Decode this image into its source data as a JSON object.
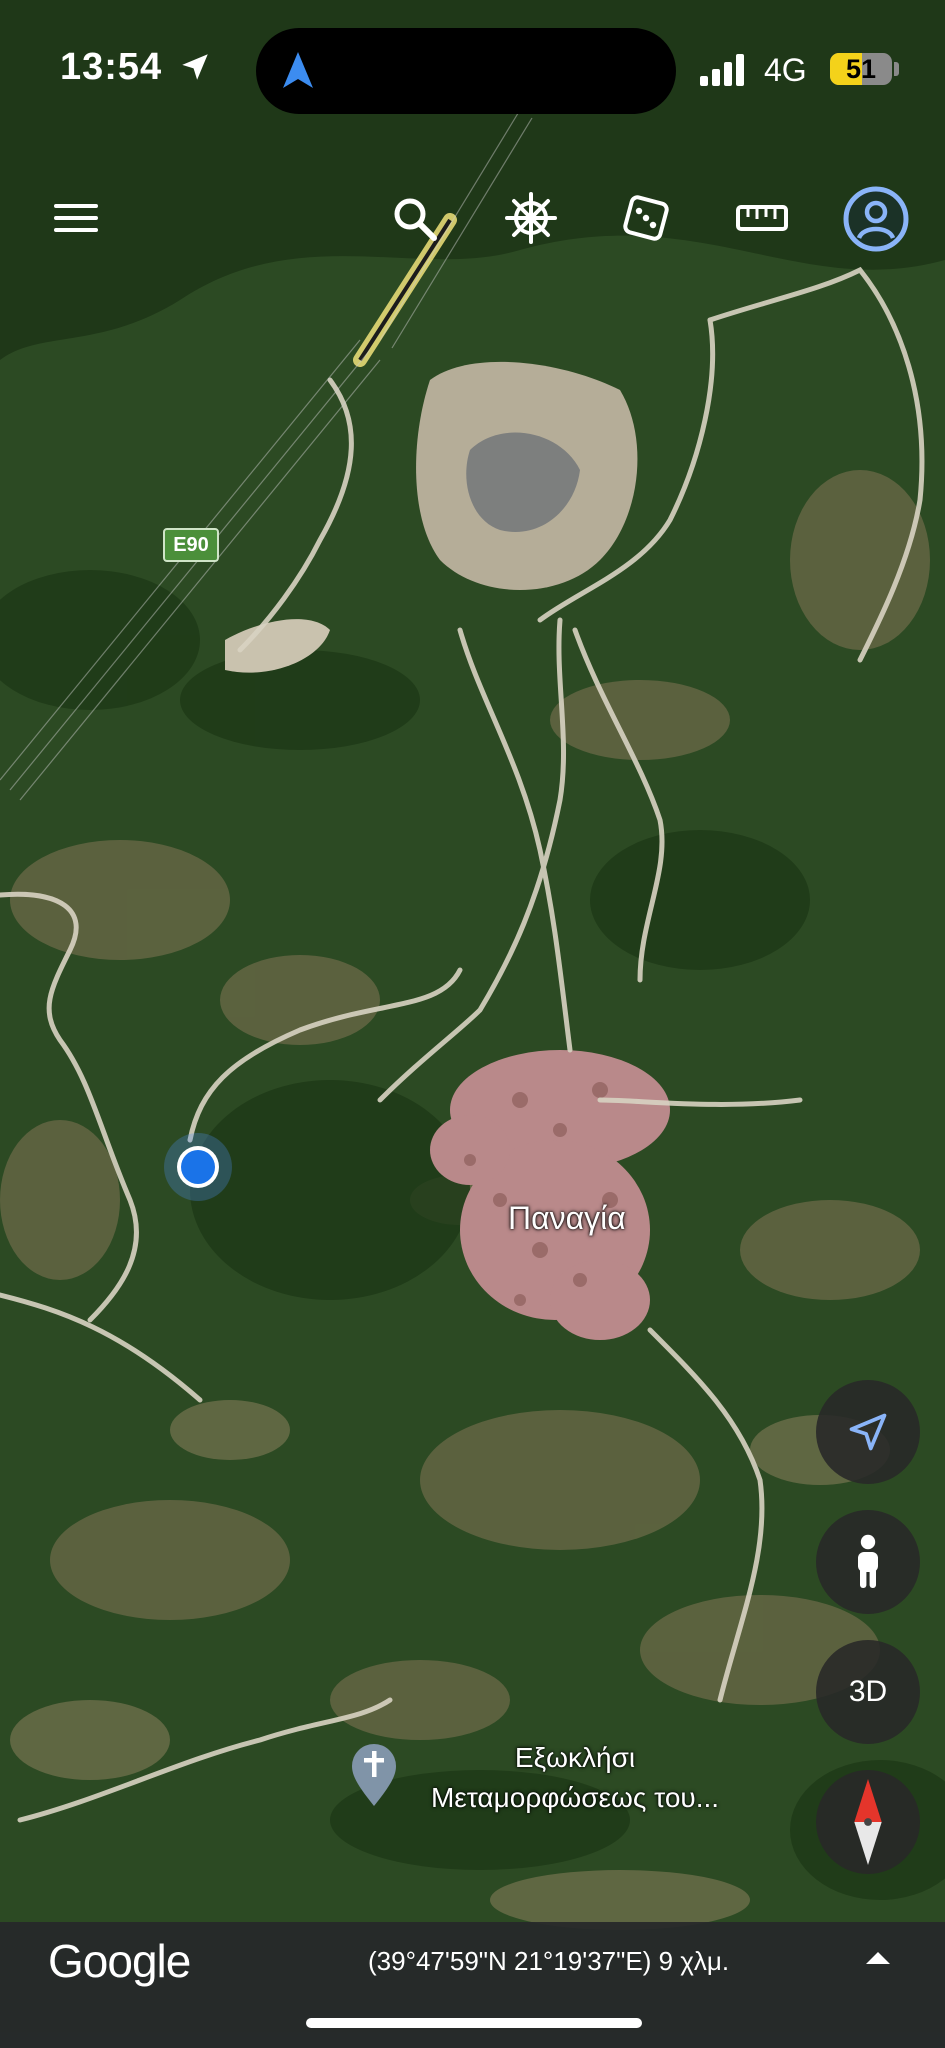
{
  "status_bar": {
    "time": "13:54",
    "network": "4G",
    "battery": "51",
    "battery_level": 0.51
  },
  "toolbar": {
    "menu_icon": "hamburger-menu-icon",
    "search_icon": "search-icon",
    "voyager_icon": "ship-wheel-icon",
    "random_icon": "dice-icon",
    "measure_icon": "ruler-icon",
    "account_icon": "user-avatar-icon"
  },
  "map": {
    "road_shield": "E90",
    "place_label": "Παναγία",
    "poi": {
      "icon": "cross-pin-icon",
      "line1": "Εξωκλήσι",
      "line2": "Μεταμορφώσεως του..."
    },
    "colors": {
      "location_dot": "#1a73e8",
      "accent_blue": "#4f8ff7",
      "village": "#b9898a",
      "vegetation": "#2f4d22"
    }
  },
  "controls": {
    "location_button_icon": "navigation-arrow-icon",
    "pegman_icon": "pegman-icon",
    "three_d_label": "3D",
    "compass_icon": "compass-icon"
  },
  "bottom_bar": {
    "logo": "Google",
    "coordinates": "(39°47'59\"N 21°19'37\"E) 9 χλμ.",
    "expand_icon": "chevron-up-icon"
  }
}
